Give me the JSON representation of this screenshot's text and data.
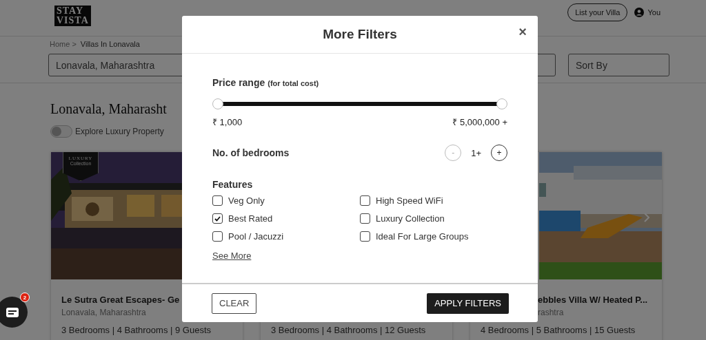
{
  "header": {
    "logo": [
      "STAY",
      "VISTA"
    ],
    "list_button": "List your Villa",
    "account": "You"
  },
  "breadcrumb": [
    "Home >",
    "Villas In Lonavala"
  ],
  "search": {
    "location": "Lonavala, Maharashtra",
    "sort": {
      "placeholder": "Sort By"
    }
  },
  "page_title": "Lonavala, Maharasht",
  "luxury_toggle": {
    "label": "Explore Luxury Property",
    "on": false
  },
  "cards": [
    {
      "title": "Le Sutra Great Escapes- Ge",
      "location": "Lonavala, Maharashtra",
      "specs": "3 Bedrooms | 4 Bathrooms | 9 Guests",
      "badge": [
        "LUXURY",
        "Collection"
      ],
      "image": {
        "kind": "picture"
      }
    },
    {
      "specs": "3 Bedrooms | 4 Bathrooms | 12 Guests"
    },
    {
      "title": "ebbles Villa W/ Heated P...",
      "location": "rashtra",
      "specs": "4 Bedrooms | 5 Bathrooms | 15 Guests",
      "image": {
        "kind": "picture"
      }
    }
  ],
  "chat": {
    "badge": "2"
  },
  "modal": {
    "title": "More Filters",
    "close": "×",
    "price": {
      "label": "Price range",
      "note": "(for total cost)",
      "thumbs": [
        {
          "level": 0
        },
        {
          "level": 1
        }
      ],
      "min_label": "₹ 1,000",
      "max_label": "₹ 5,000,000 +"
    },
    "bedrooms": {
      "label": "No. of bedrooms",
      "minus": "-",
      "minus_disabled": true,
      "value": "1+",
      "plus": "+"
    },
    "features": {
      "label": "Features",
      "items": [
        {
          "label": "Veg Only",
          "checked": false
        },
        {
          "label": "High Speed WiFi",
          "checked": false
        },
        {
          "label": "Best Rated",
          "checked": true
        },
        {
          "label": "Luxury Collection",
          "checked": false
        },
        {
          "label": "Pool / Jacuzzi",
          "checked": false
        },
        {
          "label": "Ideal For Large Groups",
          "checked": false
        }
      ],
      "see_more": "See More"
    },
    "clear": "CLEAR",
    "apply": "APPLY FILTERS"
  }
}
